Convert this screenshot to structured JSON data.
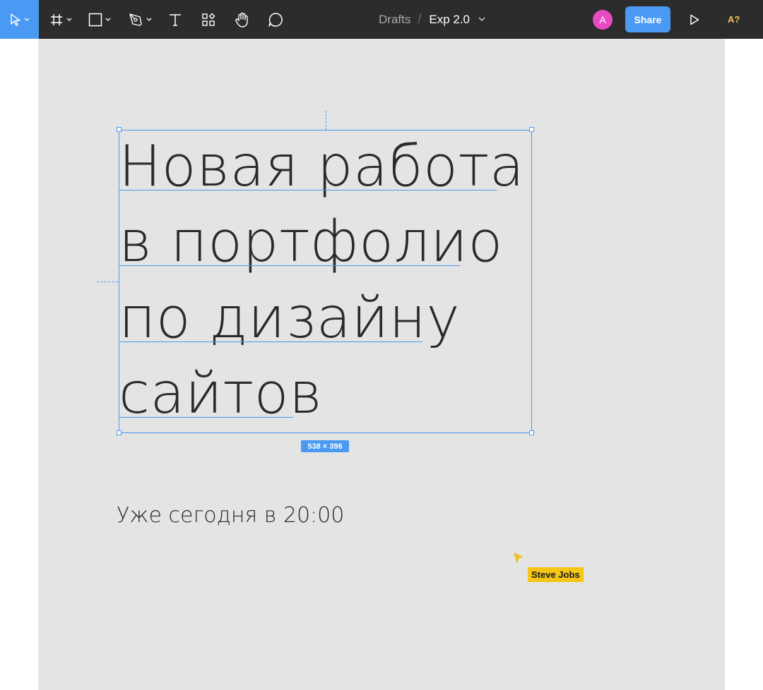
{
  "toolbar": {
    "tools": [
      {
        "icon": "move-icon",
        "active": true,
        "has_dropdown": true
      },
      {
        "icon": "frame-icon",
        "has_dropdown": true
      },
      {
        "icon": "rectangle-icon",
        "has_dropdown": true
      },
      {
        "icon": "pen-icon",
        "has_dropdown": true
      },
      {
        "icon": "text-icon"
      },
      {
        "icon": "components-icon"
      },
      {
        "icon": "hand-icon"
      },
      {
        "icon": "comment-icon"
      }
    ],
    "breadcrumb": {
      "folder": "Drafts",
      "separator": "/",
      "file": "Exp 2.0"
    },
    "avatar_initial": "A",
    "share_label": "Share",
    "play_icon": "play-icon",
    "font_warning": "A?",
    "colors": {
      "bar": "#2c2c2c",
      "accent": "#4a99f2",
      "avatar": "#e84ac2",
      "warning": "#f1c45a"
    }
  },
  "canvas": {
    "background": "#e4e4e4",
    "headline_lines": [
      "Новая работа",
      "в портфолио",
      "по дизайну",
      "сайтов"
    ],
    "subtitle": "Уже сегодня в 20:00",
    "selection_size": "538 × 396",
    "collaborator": {
      "name": "Steve Jobs",
      "color": "#f5c518"
    }
  }
}
